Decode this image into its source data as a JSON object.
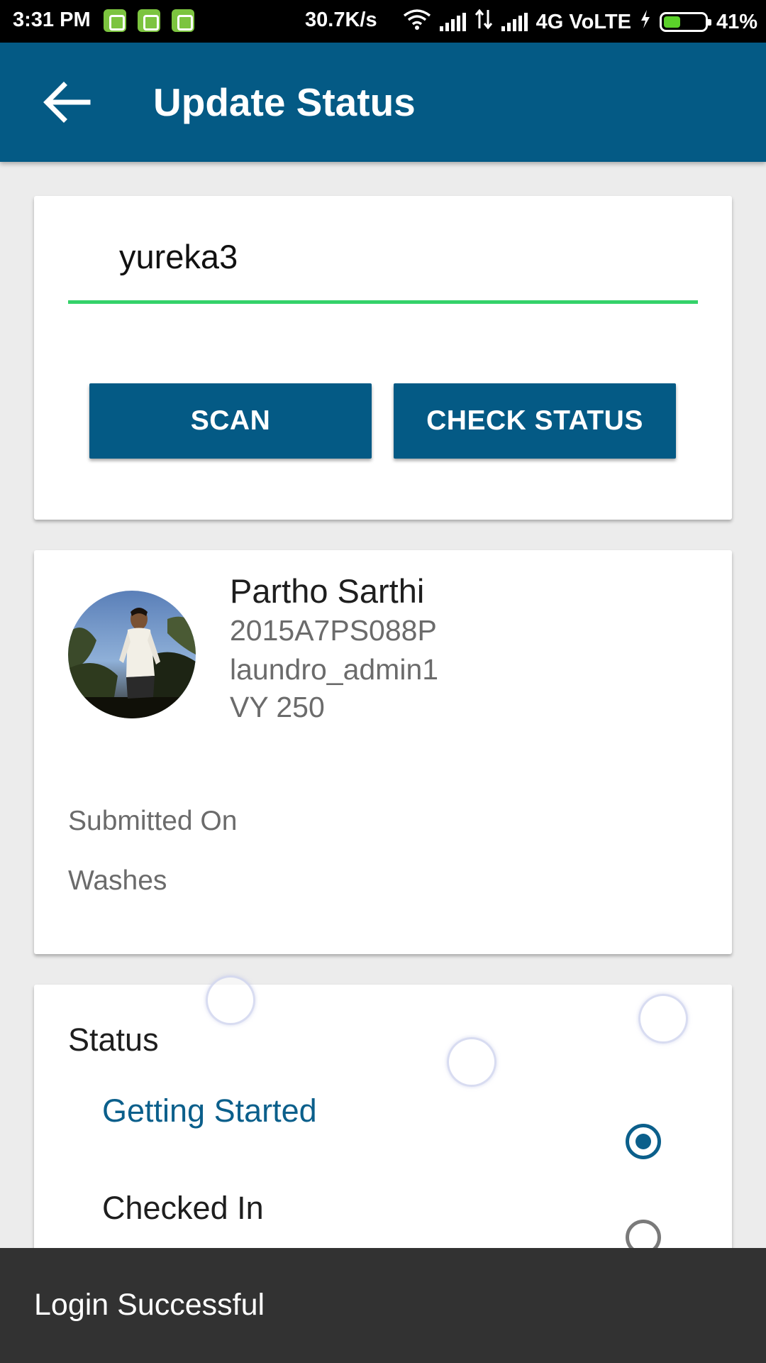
{
  "status_bar": {
    "time": "3:31 PM",
    "speed": "30.7K/s",
    "network": "4G VoLTE",
    "battery": "41%",
    "battery_level": 0.41,
    "notification_icons": [
      "android-icon",
      "battery-saver-icon",
      "android-icon"
    ]
  },
  "toolbar": {
    "title": "Update Status",
    "back_icon": "arrow-left-icon"
  },
  "search_card": {
    "input_value": "yureka3",
    "scan_label": "SCAN",
    "check_status_label": "CHECK STATUS"
  },
  "profile_card": {
    "name": "Partho Sarthi",
    "id": "2015A7PS088P",
    "admin": "laundro_admin1",
    "room": "VY 250",
    "submitted_on_label": "Submitted On",
    "washes_label": "Washes"
  },
  "status_card": {
    "title": "Status",
    "options": [
      {
        "label": "Getting Started",
        "selected": true
      },
      {
        "label": "Checked In",
        "selected": false
      }
    ]
  },
  "snackbar": {
    "message": "Login Successful"
  },
  "colors": {
    "primary": "#045a85",
    "accent_underline": "#35d26a",
    "selected_option": "#0b5f8b",
    "snackbar_bg": "#323232"
  }
}
